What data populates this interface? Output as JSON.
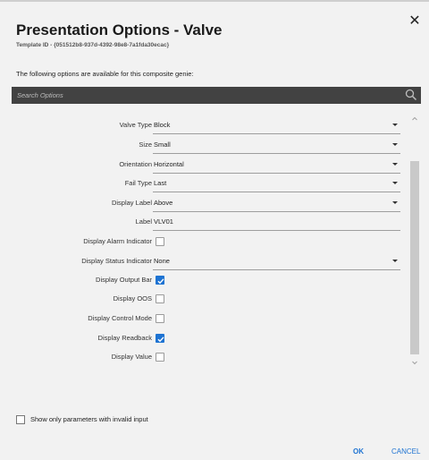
{
  "dialog": {
    "title": "Presentation Options - Valve",
    "template_id": "Template ID - {051512b8-937d-4392-98e8-7a1fda30ecac}",
    "subtitle": "The following options are available for this composite genie:",
    "close_icon": "close-icon"
  },
  "search": {
    "placeholder": "Search Options",
    "icon": "search-icon"
  },
  "options": [
    {
      "label": "Valve Type",
      "type": "select",
      "value": "Block"
    },
    {
      "label": "Size",
      "type": "select",
      "value": "Small"
    },
    {
      "label": "Orientation",
      "type": "select",
      "value": "Horizontal"
    },
    {
      "label": "Fail Type",
      "type": "select",
      "value": "Last"
    },
    {
      "label": "Display Label",
      "type": "select",
      "value": "Above"
    },
    {
      "label": "Label",
      "type": "text",
      "value": "VLV01"
    },
    {
      "label": "Display Alarm Indicator",
      "type": "checkbox",
      "checked": false
    },
    {
      "label": "Display Status Indicator",
      "type": "select",
      "value": "None"
    },
    {
      "label": "Display Output Bar",
      "type": "checkbox",
      "checked": true
    },
    {
      "label": "Display OOS",
      "type": "checkbox",
      "checked": false
    },
    {
      "label": "Display Control Mode",
      "type": "checkbox",
      "checked": false
    },
    {
      "label": "Display Readback",
      "type": "checkbox",
      "checked": true
    },
    {
      "label": "Display Value",
      "type": "checkbox",
      "checked": false
    }
  ],
  "footer": {
    "filter_label": "Show only parameters with invalid input",
    "filter_checked": false,
    "ok_label": "OK",
    "cancel_label": "CANCEL"
  },
  "colors": {
    "accent": "#1e73d2",
    "searchbar": "#424242",
    "dialog_bg": "#f2f2f2"
  }
}
